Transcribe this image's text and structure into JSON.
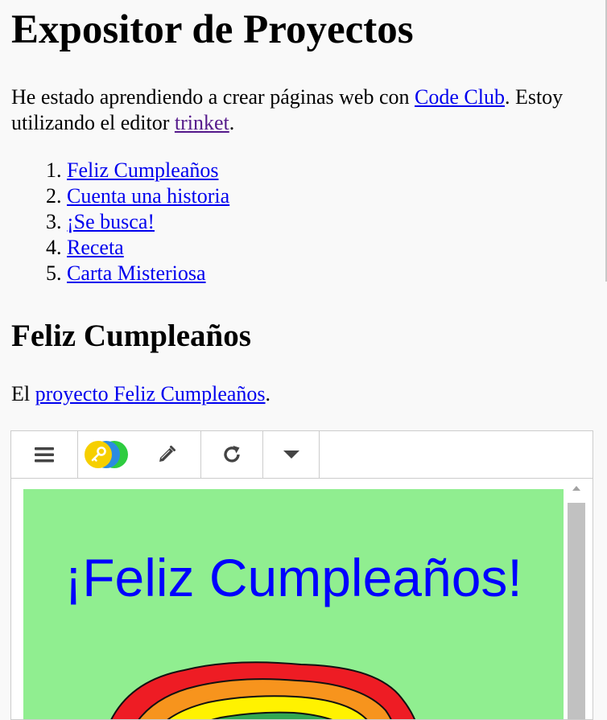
{
  "header": {
    "title": "Expositor de Proyectos"
  },
  "intro": {
    "text_before": "He estado aprendiendo a crear páginas web con ",
    "code_club_link": "Code Club",
    "text_middle": ". Estoy utilizando el editor ",
    "trinket_link": "trinket",
    "text_after": "."
  },
  "projects": [
    {
      "label": "Feliz Cumpleaños"
    },
    {
      "label": "Cuenta una historia"
    },
    {
      "label": "¡Se busca!"
    },
    {
      "label": "Receta"
    },
    {
      "label": "Carta Misteriosa"
    }
  ],
  "section": {
    "heading": "Feliz Cumpleaños",
    "text_before": "El ",
    "link": "proyecto Feliz Cumpleaños",
    "text_after": "."
  },
  "trinket": {
    "toolbar_icons": [
      "menu-icon",
      "key-icon",
      "pencil-icon",
      "refresh-icon",
      "caret-down-icon"
    ],
    "output_greeting": "¡Feliz Cumpleaños!",
    "colors": {
      "canvas_bg": "#90ee90",
      "greeting": "#0000ff",
      "rainbow": [
        "#ee1c24",
        "#f7941d",
        "#fff200",
        "#32a852"
      ]
    }
  }
}
